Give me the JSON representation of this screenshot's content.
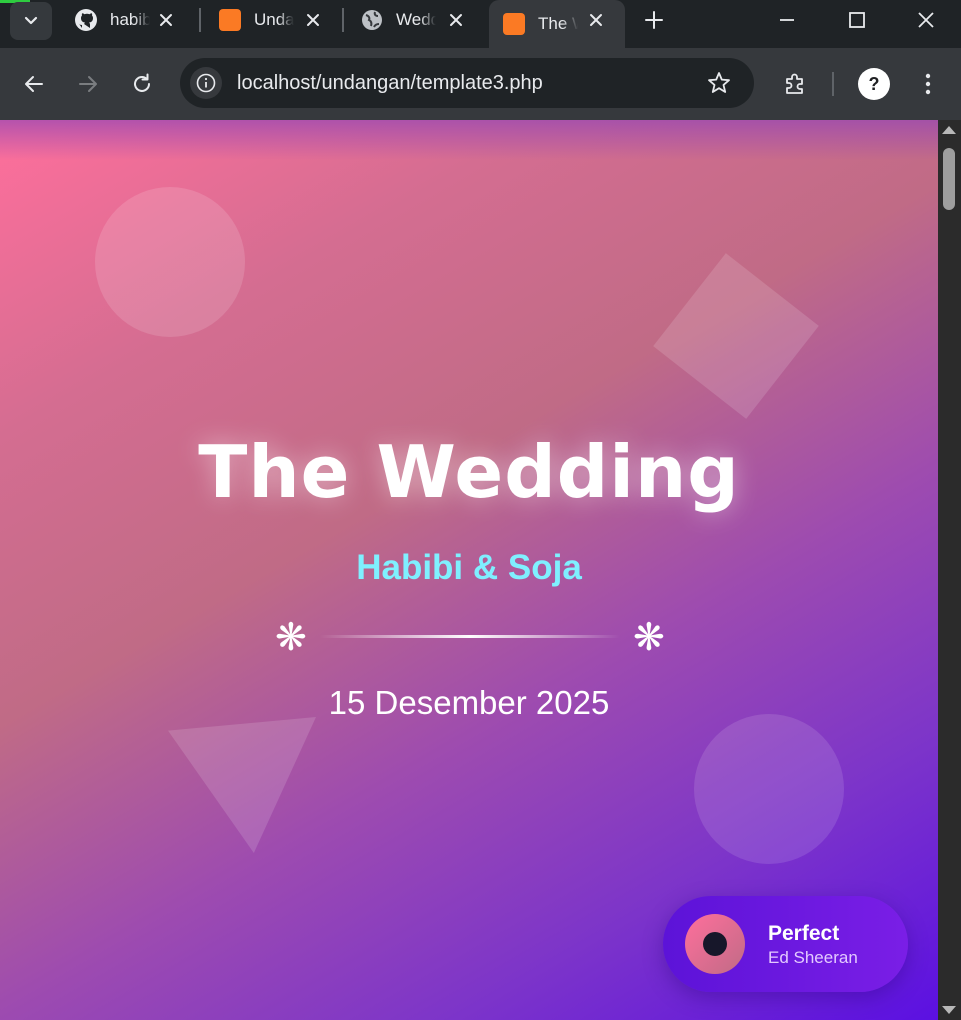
{
  "browser": {
    "tabs": [
      {
        "title": "habibi",
        "icon": "github-icon",
        "active": false
      },
      {
        "title": "Undangan",
        "icon": "xampp-icon",
        "active": false
      },
      {
        "title": "Wedding",
        "icon": "globe-icon",
        "active": false
      },
      {
        "title": "The Wedding",
        "icon": "xampp-icon",
        "active": true
      }
    ],
    "url": "localhost/undangan/template3.php"
  },
  "page": {
    "title": "The Wedding",
    "couple": "Habibi & Soja",
    "divider_symbol": "❋",
    "date": "15 Desember 2025",
    "music": {
      "song": "Perfect",
      "artist": "Ed Sheeran"
    }
  },
  "colors": {
    "gradient_start": "#ff6f9c",
    "gradient_end": "#5b10e2",
    "couple_names": "#7ff0ff",
    "player_bg": "#5c13d8"
  }
}
